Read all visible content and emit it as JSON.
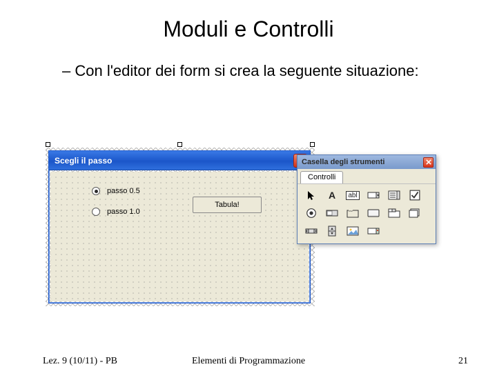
{
  "slide": {
    "title": "Moduli e Controlli",
    "bullet": "Con l'editor dei form si crea la seguente situazione:"
  },
  "form": {
    "title": "Scegli il passo",
    "radio1": "passo 0.5",
    "radio2": "passo 1.0",
    "button": "Tabula!"
  },
  "toolbox": {
    "title": "Casella degli strumenti",
    "tab": "Controlli",
    "tools": {
      "pointer": "pointer-icon",
      "label": "A",
      "textbox": "abl",
      "combobox": "combobox-icon",
      "listbox": "listbox-icon",
      "checkbox": "checkbox-icon",
      "option": "option-icon",
      "toggle": "toggle-icon",
      "frame": "frame-icon",
      "command": "command-icon",
      "tabstrip": "tabstrip-icon",
      "multipage": "multipage-icon",
      "scrollbar": "scrollbar-icon",
      "spin": "spin-icon",
      "image": "image-icon",
      "refedit": "refedit-icon"
    }
  },
  "footer": {
    "left": "Lez. 9 (10/11) - PB",
    "center": "Elementi di Programmazione",
    "page": "21"
  }
}
